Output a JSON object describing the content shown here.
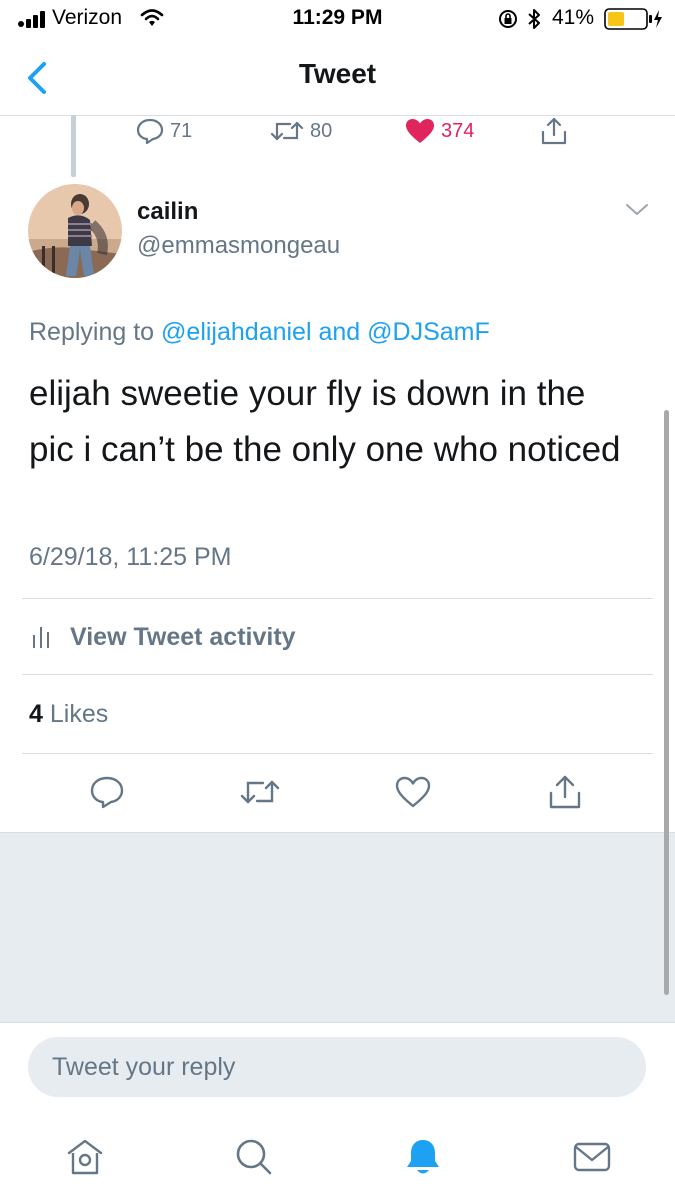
{
  "status_bar": {
    "carrier": "Verizon",
    "time": "11:29 PM",
    "battery": "41%"
  },
  "nav": {
    "title": "Tweet"
  },
  "parent_stats": {
    "replies": "71",
    "retweets": "80",
    "likes": "374"
  },
  "tweet": {
    "name": "cailin",
    "handle": "@emmasmongeau",
    "replying_prefix": "Replying to",
    "mention1": "@elijahdaniel",
    "and_text": "and",
    "mention2": "@DJSamF",
    "text": "elijah sweetie your fly is down in the pic i can’t be the only one who noticed",
    "timestamp": "6/29/18, 11:25 PM",
    "activity_label": "View Tweet activity",
    "likes_count": "4",
    "likes_label": "Likes"
  },
  "reply": {
    "placeholder": "Tweet your reply"
  },
  "colors": {
    "accent": "#1da1f2",
    "like": "#e0245e",
    "muted": "#657786",
    "background_gray": "#e6ecf0"
  },
  "icons": {
    "tabs": [
      "home-icon",
      "search-icon",
      "notifications-icon",
      "messages-icon"
    ],
    "actions": [
      "reply-icon",
      "retweet-icon",
      "like-icon",
      "share-icon"
    ]
  }
}
